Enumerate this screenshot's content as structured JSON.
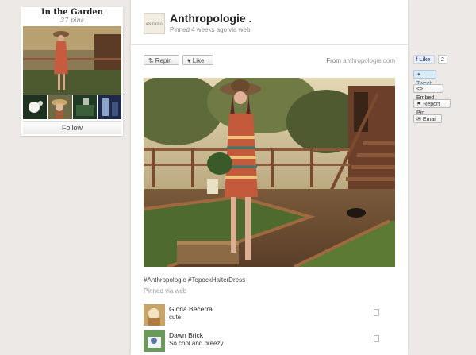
{
  "board": {
    "title": "In the Garden",
    "pin_count": "37 pins",
    "follow_label": "Follow"
  },
  "pin": {
    "pinner_name": "Anthropologie .",
    "avatar_text": "ANTHRO",
    "pinned_meta": "Pinned 4 weeks ago via web",
    "repin_label": "Repin",
    "like_label": "Like",
    "from_prefix": "From",
    "from_domain": "anthropologie.com",
    "caption": "#Anthropologie #TopockHalterDress",
    "pinned_via": "Pinned via web"
  },
  "comments": [
    {
      "name": "Gloria Becerra",
      "text": "cute"
    },
    {
      "name": "Dawn Brick",
      "text": "So cool and breezy"
    }
  ],
  "social": {
    "fb_label": "Like",
    "fb_count": "2",
    "tweet_label": "Tweet",
    "embed_label": "Embed",
    "report_label": "Report Pin",
    "email_label": "Email"
  },
  "icons": {
    "repin": "repin-icon",
    "like": "heart-icon",
    "facebook": "facebook-icon",
    "twitter": "twitter-icon",
    "embed": "embed-icon",
    "report": "flag-icon",
    "email": "email-icon"
  },
  "colors": {
    "background": "#ece9e6",
    "facebook": "#3b5998",
    "twitter": "#2b6a99"
  }
}
